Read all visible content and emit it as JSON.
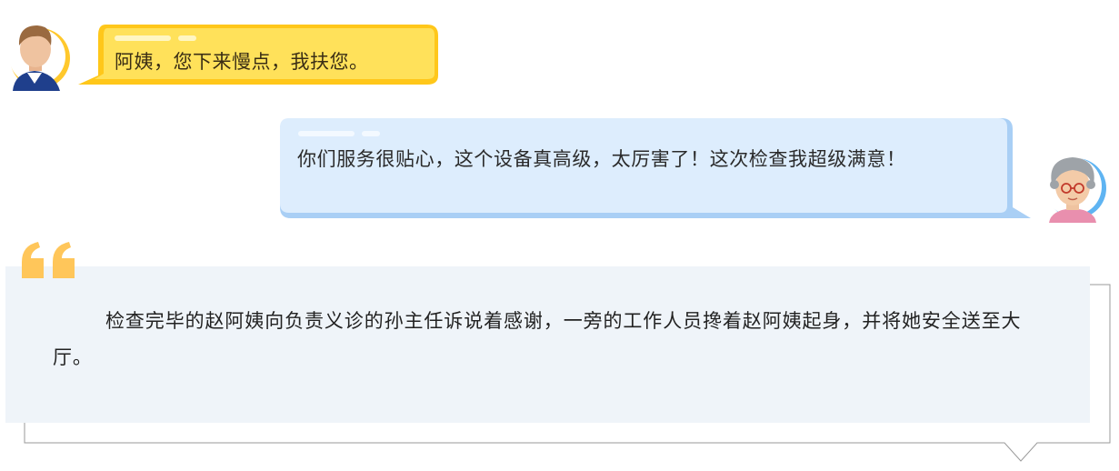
{
  "dialogue": [
    {
      "speaker": "staff",
      "text": "阿姨，您下来慢点，我扶您。",
      "bubble_color": "#ffd029"
    },
    {
      "speaker": "patient",
      "text": "你们服务很贴心，这个设备真高级，太厉害了！这次检查我超级满意！",
      "bubble_color": "#dcecfd"
    }
  ],
  "narration": {
    "text": "检查完毕的赵阿姨向负责义诊的孙主任诉说着感谢，一旁的工作人员搀着赵阿姨起身，并将她安全送至大厅。",
    "quote_color": "#ffc65a",
    "panel_color": "#eff4f9"
  }
}
